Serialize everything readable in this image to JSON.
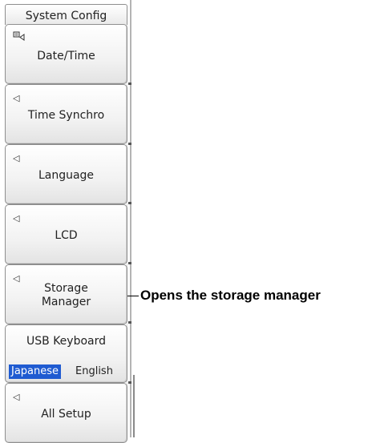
{
  "menu": {
    "title": "System Config",
    "items": [
      {
        "label": "Date/Time",
        "icon": "keyboard-edit-icon"
      },
      {
        "label": "Time Synchro",
        "icon": "triangle-left-icon"
      },
      {
        "label": "Language",
        "icon": "triangle-left-icon"
      },
      {
        "label": "LCD",
        "icon": "triangle-left-icon"
      },
      {
        "label": "Storage Manager",
        "icon": "triangle-left-icon"
      },
      {
        "label": "All Setup",
        "icon": "triangle-left-icon"
      }
    ],
    "usb_keyboard": {
      "label": "USB Keyboard",
      "options": [
        "Japanese",
        "English"
      ],
      "selected": "Japanese"
    }
  },
  "callout": {
    "text": "Opens the storage manager"
  },
  "colors": {
    "selected_option": "#1f5bd1",
    "button_border": "#8f8f8f"
  }
}
